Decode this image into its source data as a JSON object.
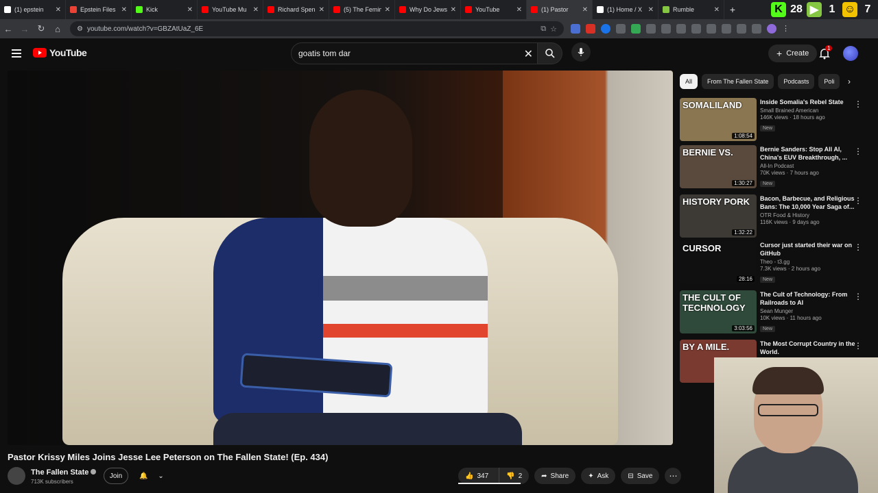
{
  "browser": {
    "tabs": [
      {
        "label": "(1) epstein",
        "fav": "#ffffff"
      },
      {
        "label": "Epstein Files",
        "fav": "#ea4335"
      },
      {
        "label": "Kick",
        "fav": "#53fc18"
      },
      {
        "label": "YouTube Mu",
        "fav": "#ff0000"
      },
      {
        "label": "Richard Spen",
        "fav": "#ff0000"
      },
      {
        "label": "(5) The Femin",
        "fav": "#ff0000"
      },
      {
        "label": "Why Do Jews",
        "fav": "#ff0000"
      },
      {
        "label": "YouTube",
        "fav": "#ff0000"
      },
      {
        "label": "(1) Pastor",
        "fav": "#ff0000",
        "active": true
      },
      {
        "label": "(1) Home / X",
        "fav": "#ffffff"
      },
      {
        "label": "Rumble",
        "fav": "#85c742"
      }
    ],
    "ext_counter_1": "28",
    "ext_counter_2": "1",
    "ext_counter_3": "7",
    "url": "youtube.com/watch?v=GBZAtUaZ_6E"
  },
  "yt": {
    "logo_text": "YouTube",
    "search_value": "goatis tom dar",
    "create_label": "Create",
    "notif_count": "1"
  },
  "video": {
    "title": "Pastor Krissy Miles Joins Jesse Lee Peterson on The Fallen State! (Ep. 434)",
    "channel": "The Fallen State",
    "subscribers": "713K subscribers",
    "join_label": "Join",
    "likes": "347",
    "dislikes": "2",
    "share_label": "Share",
    "ask_label": "Ask",
    "save_label": "Save"
  },
  "sidebar": {
    "chips": [
      "All",
      "From The Fallen State",
      "Podcasts",
      "Poli"
    ],
    "recommendations": [
      {
        "title": "Inside Somalia's Rebel State",
        "channel": "Small Brained American",
        "meta": "146K views · 18 hours ago",
        "badge": "New",
        "duration": "1:08:54",
        "thumb_text": "SOMALILAND",
        "thumb_color": "#8a7650"
      },
      {
        "title": "Bernie Sanders: Stop All AI, China's EUV Breakthrough, ...",
        "channel": "All-In Podcast",
        "meta": "70K views · 7 hours ago",
        "badge": "New",
        "duration": "1:30:27",
        "thumb_text": "BERNIE VS.",
        "thumb_color": "#5a4a3e"
      },
      {
        "title": "Bacon, Barbecue, and Religious Bans: The 10,000 Year Saga of...",
        "channel": "OTR Food & History",
        "meta": "116K views · 9 days ago",
        "badge": "",
        "duration": "1:32:22",
        "thumb_text": "HISTORY PORK",
        "thumb_color": "#3d3a36"
      },
      {
        "title": "Cursor just started their war on GitHub",
        "channel": "Theo - t3.gg",
        "meta": "7.3K views · 2 hours ago",
        "badge": "New",
        "duration": "28:16",
        "thumb_text": "CURSOR",
        "thumb_color": "#101010"
      },
      {
        "title": "The Cult of Technology: From Railroads to AI",
        "channel": "Sean Munger",
        "meta": "10K views · 11 hours ago",
        "badge": "New",
        "duration": "3:03:56",
        "thumb_text": "THE CULT OF TECHNOLOGY",
        "thumb_color": "#2f4a3a"
      },
      {
        "title": "The Most Corrupt Country in the World.",
        "channel": "",
        "meta": "",
        "badge": "",
        "duration": "",
        "thumb_text": "BY A MILE.",
        "thumb_color": "#7a3a30"
      }
    ]
  }
}
